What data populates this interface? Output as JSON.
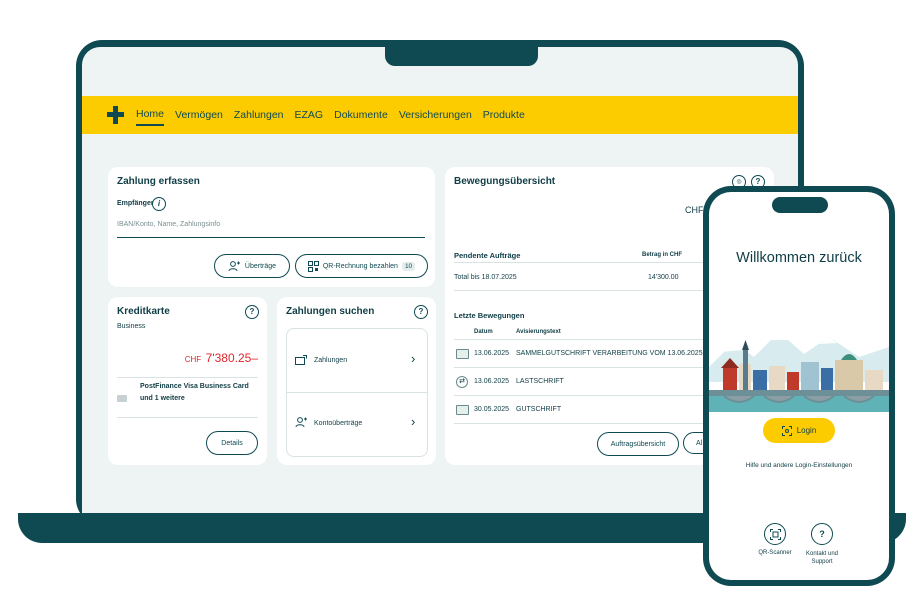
{
  "nav": {
    "items": [
      "Home",
      "Vermögen",
      "Zahlungen",
      "EZAG",
      "Dokumente",
      "Versicherungen",
      "Produkte"
    ],
    "active": "Home"
  },
  "zahlung": {
    "title": "Zahlung erfassen",
    "empfaenger_label": "Empfänger",
    "empfaenger_placeholder": "IBAN/Konto, Name, Zahlungsinfo",
    "uebertraege_button": "Überträge",
    "qr_button": "QR-Rechnung bezahlen",
    "qr_badge": "10"
  },
  "kredit": {
    "title": "Kreditkarte",
    "subtitle": "Business",
    "currency": "CHF",
    "amount": "7'380.25–",
    "card_name": "PostFinance Visa Business Card",
    "card_more": "und 1 weitere",
    "details_button": "Details"
  },
  "suchen": {
    "title": "Zahlungen suchen",
    "item1": "Zahlungen",
    "item2": "Kontoüberträge"
  },
  "bewegung": {
    "title": "Bewegungsübersicht",
    "currency": "CHF",
    "pending_title": "Pendente Aufträge",
    "pending_col": "Betrag in CHF",
    "pending_row_label": "Total bis 18.07.2025",
    "pending_row_value": "14'300.00",
    "recent_title": "Letzte Bewegungen",
    "col_date": "Datum",
    "col_text": "Avisierungstext",
    "rows": [
      {
        "date": "13.06.2025",
        "text": "SAMMELGUTSCHRIFT VERARBEITUNG VOM 13.06.2025"
      },
      {
        "date": "13.06.2025",
        "text": "LASTSCHRIFT"
      },
      {
        "date": "30.05.2025",
        "text": "GUTSCHRIFT"
      }
    ],
    "auftrag_button": "Auftragsübersicht",
    "all_button": "Al"
  },
  "phone": {
    "welcome": "Willkommen zurück",
    "login_button": "Login",
    "help_link": "Hilfe und andere Login-Einstellungen",
    "qr_scanner": "QR-Scanner",
    "kontakt_line1": "Kontakt und",
    "kontakt_line2": "Support"
  },
  "colors": {
    "brand_yellow": "#fccc00",
    "petrol": "#0f4a52",
    "alert_red": "#e3262d"
  }
}
